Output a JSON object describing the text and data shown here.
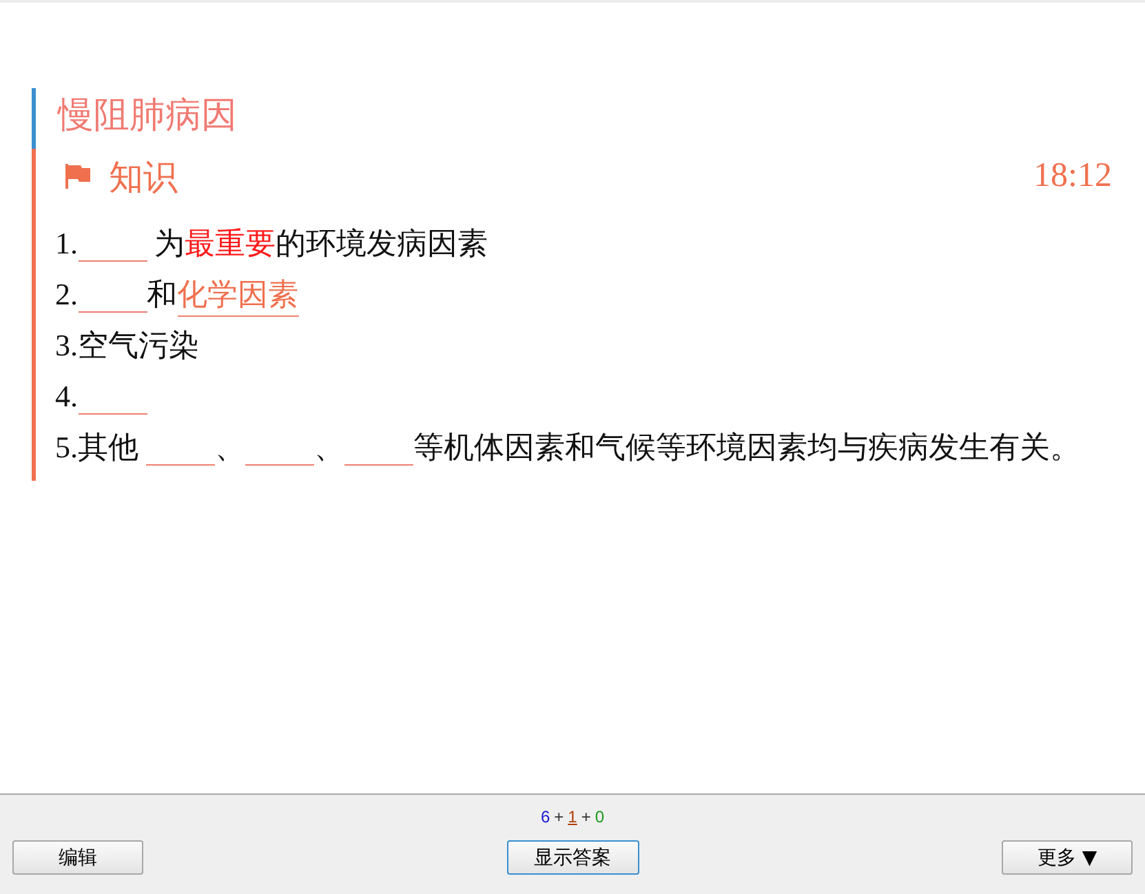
{
  "card": {
    "title": "慢阻肺病因",
    "section": {
      "label": "知识"
    },
    "time": "18:12",
    "lines": [
      [
        {
          "kind": "text",
          "text": "1."
        },
        {
          "kind": "blank"
        },
        {
          "kind": "text",
          "text": " 为"
        },
        {
          "kind": "emphasis",
          "text": "最重要"
        },
        {
          "kind": "text",
          "text": "的环境发病因素"
        }
      ],
      [
        {
          "kind": "text",
          "text": "2."
        },
        {
          "kind": "blank"
        },
        {
          "kind": "text",
          "text": "和"
        },
        {
          "kind": "term",
          "text": "化学因素"
        }
      ],
      [
        {
          "kind": "text",
          "text": "3.空气污染"
        }
      ],
      [
        {
          "kind": "text",
          "text": "4."
        },
        {
          "kind": "blank"
        }
      ],
      [
        {
          "kind": "text",
          "text": "5.其他 "
        },
        {
          "kind": "blank"
        },
        {
          "kind": "text",
          "text": "、"
        },
        {
          "kind": "blank"
        },
        {
          "kind": "text",
          "text": "、"
        },
        {
          "kind": "blank"
        },
        {
          "kind": "text",
          "text": "等机体因素和气候等环境因素均与疾病发生有关。"
        }
      ]
    ]
  },
  "status_bar": {
    "counts": [
      {
        "kind": "new",
        "text": "6"
      },
      {
        "kind": "sep",
        "text": "+"
      },
      {
        "kind": "learn",
        "text": "1"
      },
      {
        "kind": "sep",
        "text": "+"
      },
      {
        "kind": "review",
        "text": "0"
      }
    ],
    "buttons": [
      {
        "kind": "left",
        "label": "编辑"
      },
      {
        "kind": "center",
        "label": "显示答案"
      },
      {
        "kind": "right",
        "label": "更多 ▼"
      }
    ]
  }
}
